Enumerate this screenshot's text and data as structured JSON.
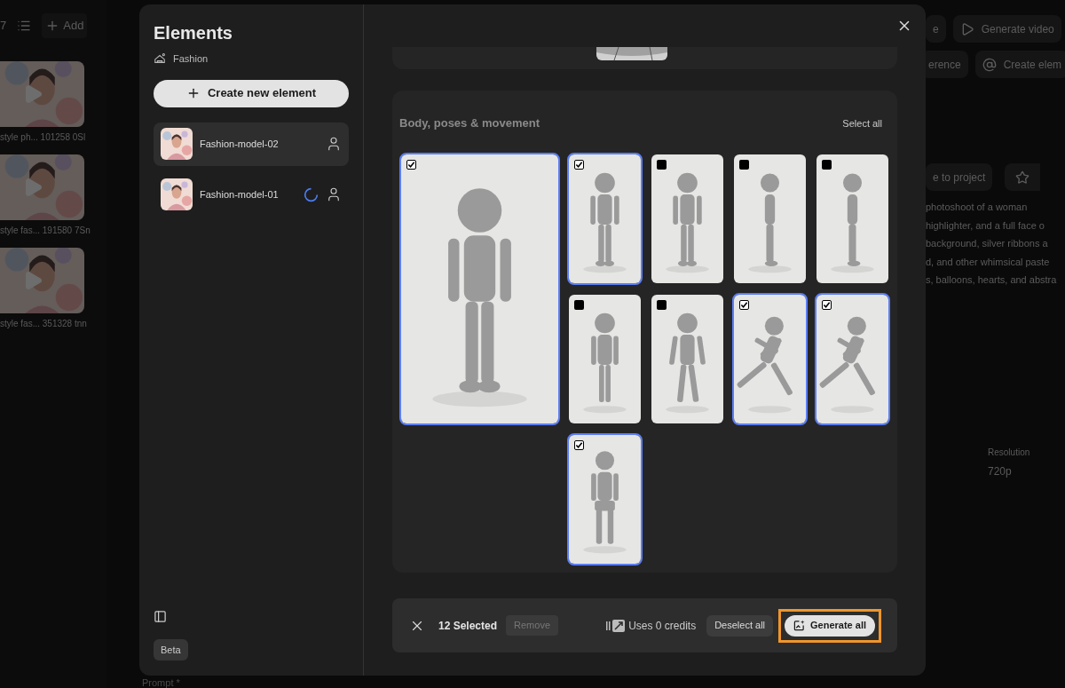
{
  "background": {
    "toolbar": {
      "count": "7",
      "add": "Add"
    },
    "videos": [
      {
        "caption": "style ph... 101258 0Sl"
      },
      {
        "caption": "style fas... 191580 7Sn"
      },
      {
        "caption": "style fas... 351328 tnn"
      }
    ],
    "actions": [
      {
        "label": "e",
        "icon": false
      },
      {
        "label": "Generate video",
        "icon": true
      }
    ],
    "actions_row2": [
      {
        "label": "erence",
        "icon": false
      },
      {
        "label": "Create elem",
        "icon": true
      }
    ],
    "add_to_project": "e to project",
    "prompt_lines": [
      "photoshoot of a woman",
      "highlighter, and a full face o",
      "background, silver ribbons a",
      "d, and other whimsical paste",
      "s, balloons, hearts, and abstra"
    ],
    "resolution_label": "Resolution",
    "resolution": "720p",
    "prompt_label": "Prompt *"
  },
  "dialog": {
    "title": "Elements",
    "category": "Fashion",
    "create_button": "Create new element",
    "elements": [
      {
        "name": "Fashion-model-02",
        "selected": true,
        "loading": false
      },
      {
        "name": "Fashion-model-01",
        "selected": false,
        "loading": true
      }
    ],
    "beta": "Beta",
    "section": {
      "title": "Body, poses & movement",
      "select_all": "Select all",
      "images": [
        {
          "selected": true,
          "kind": "picture"
        },
        {
          "selected": true,
          "kind": "picture"
        },
        {
          "selected": false,
          "kind": "picture"
        },
        {
          "selected": false,
          "kind": "picture"
        },
        {
          "selected": false,
          "kind": "picture"
        },
        {
          "selected": false,
          "kind": "picture"
        },
        {
          "selected": false,
          "kind": "picture"
        },
        {
          "selected": true,
          "kind": "picture"
        },
        {
          "selected": true,
          "kind": "picture"
        },
        {
          "selected": true,
          "kind": "picture"
        }
      ]
    },
    "footer": {
      "count": "12 Selected",
      "remove": "Remove",
      "credits": "Uses 0 credits",
      "deselect": "Deselect all",
      "generate": "Generate all",
      "generate_highlighted": true
    }
  }
}
